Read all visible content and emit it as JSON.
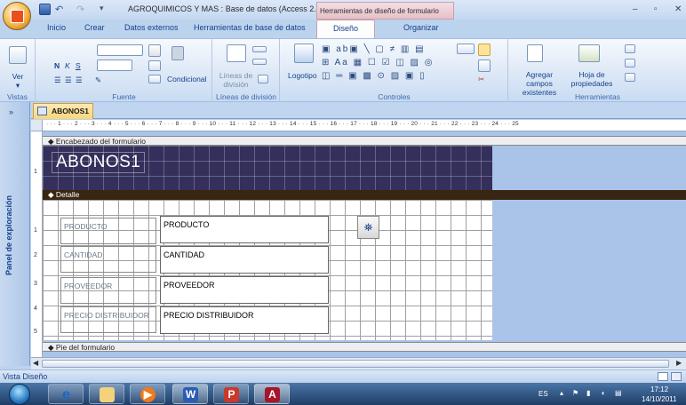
{
  "window": {
    "title": "AGROQUIMICOS Y MAS : Base de datos (Access 2... M",
    "context_tab_title": "Herramientas de diseño de formulario",
    "minimize": "–",
    "restore": "▫",
    "close": "✕"
  },
  "tabs": [
    {
      "label": "Inicio"
    },
    {
      "label": "Crear"
    },
    {
      "label": "Datos externos"
    },
    {
      "label": "Herramientas de base de datos"
    },
    {
      "label": "Diseño"
    },
    {
      "label": "Organizar"
    }
  ],
  "ribbon": {
    "vistas": {
      "label": "Vistas",
      "ver": "Ver"
    },
    "fuente": {
      "label": "Fuente",
      "bold": "N",
      "italic": "K",
      "underline": "S",
      "condicional": "Condicional"
    },
    "lineas": {
      "label": "Líneas de división",
      "button": "Líneas de división"
    },
    "controles": {
      "label": "Controles",
      "logotipo": "Logotipo"
    },
    "herramientas": {
      "label": "Herramientas",
      "agregar_campos": "Agregar campos existentes",
      "hoja_propiedades": "Hoja de propiedades"
    }
  },
  "nav_pane": {
    "label": "Panel de exploración",
    "toggle": "»"
  },
  "document": {
    "tab_label": "ABONOS1"
  },
  "ruler": {
    "text": "· · · 1 · · · 2 · · · 3 · · · 4 · · · 5 · · · 6 · · · 7 · · · 8 · · · 9 · · · 10 · · · 11 · · · 12 · · · 13 · · · 14 · · · 15 · · · 16 · · · 17 · · · 18 · · · 19 · · · 20 · · · 21 · · · 22 · · · 23 · · · 24 · · · 25"
  },
  "form": {
    "header_section": "Encabezado del formulario",
    "title": "ABONOS1",
    "detail_section": "Detalle",
    "footer_section": "Pie del formulario",
    "fields": [
      {
        "label": "PRODUCTO",
        "control": "PRODUCTO"
      },
      {
        "label": "CANTIDAD",
        "control": "CANTIDAD"
      },
      {
        "label": "PROVEEDOR",
        "control": "PROVEEDOR"
      },
      {
        "label": "PRECIO DISTRIBUIDOR",
        "control": "PRECIO DISTRIBUIDOR"
      }
    ]
  },
  "status": {
    "text": "Vista Diseño"
  },
  "taskbar": {
    "apps": [
      {
        "icon": "internet-explorer-icon"
      },
      {
        "icon": "file-explorer-icon"
      },
      {
        "icon": "media-player-icon"
      },
      {
        "icon": "word-icon"
      },
      {
        "icon": "powerpoint-icon"
      },
      {
        "icon": "access-icon"
      }
    ],
    "tray": {
      "language": "ES",
      "time": "17:12",
      "date": "14/10/2011"
    }
  }
}
